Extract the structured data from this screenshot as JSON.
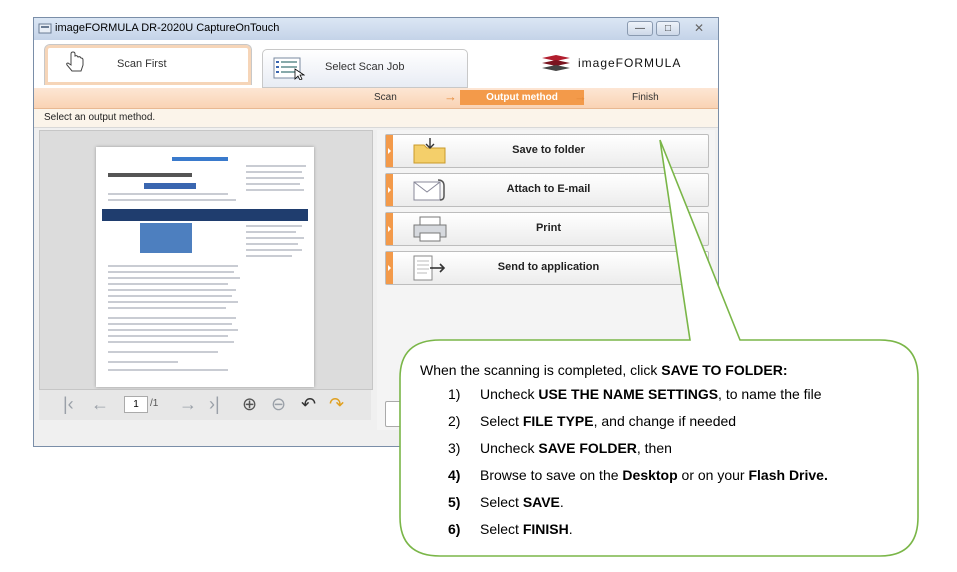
{
  "window": {
    "title": "imageFORMULA DR-2020U CaptureOnTouch",
    "min_glyph": "—",
    "max_glyph": "□",
    "close_glyph": "✕"
  },
  "tabs": [
    {
      "label": "Scan First",
      "icon": "hand-pointer-icon"
    },
    {
      "label": "Select Scan Job",
      "icon": "job-list-icon"
    }
  ],
  "brand": {
    "text": "imageFORMULA",
    "icon": "canon-stack-icon"
  },
  "steps": {
    "items": [
      "Scan",
      "Output method",
      "Finish"
    ],
    "current": "Output method",
    "arrow_glyph": "→"
  },
  "hint": "Select an output method.",
  "pager": {
    "first": "|‹",
    "prev": "←",
    "page": "1",
    "of": "/1",
    "next": "→",
    "last": "›|",
    "zoom_in": "⊕",
    "zoom_out": "⊖",
    "rotate_left": "↶",
    "rotate_right": "↷"
  },
  "actions": [
    {
      "label": "Save to folder",
      "icon": "folder-icon"
    },
    {
      "label": "Attach to E-mail",
      "icon": "email-attach-icon"
    },
    {
      "label": "Print",
      "icon": "printer-icon"
    },
    {
      "label": "Send to application",
      "icon": "send-app-icon"
    }
  ],
  "callout": {
    "intro": "When the scanning is completed, click ",
    "intro_bold": "SAVE TO FOLDER:",
    "steps": [
      {
        "num": "1)",
        "pre": "Uncheck ",
        "bold": "USE THE NAME SETTINGS",
        "post": ", to name the file",
        "bold2": "",
        "post2": ""
      },
      {
        "num": "2)",
        "pre": "Select ",
        "bold": "FILE TYPE",
        "post": ", and change if needed",
        "bold2": "",
        "post2": ""
      },
      {
        "num": "3)",
        "pre": "Uncheck ",
        "bold": "SAVE FOLDER",
        "post": ", then",
        "bold2": "",
        "post2": ""
      },
      {
        "num": "4)",
        "pre": "Browse to save on the ",
        "bold": "Desktop",
        "post": " or on your ",
        "bold2": "Flash Drive.",
        "post2": ""
      },
      {
        "num": "5)",
        "pre": "Select ",
        "bold": "SAVE",
        "post": ".",
        "bold2": "",
        "post2": ""
      },
      {
        "num": "6)",
        "pre": "Select ",
        "bold": "FINISH",
        "post": ".",
        "bold2": "",
        "post2": ""
      }
    ]
  },
  "colors": {
    "accent": "#f39a4a",
    "callout_border": "#7ab648"
  }
}
